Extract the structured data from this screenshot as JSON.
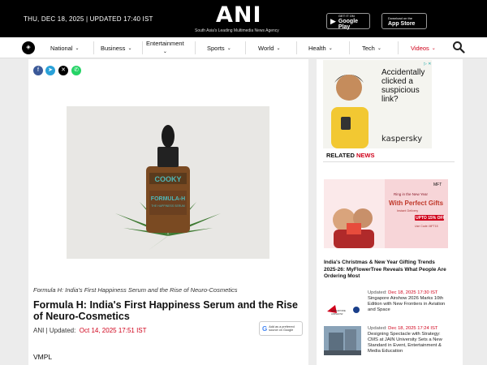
{
  "header": {
    "date_line": "THU, DEC 18, 2025 | UPDATED 17:40 IST",
    "logo": "ANI",
    "tagline": "South Asia's Leading Multimedia News Agency",
    "google_play_small": "GET IT ON",
    "google_play": "Google Play",
    "app_store_small": "Download on the",
    "app_store": "App Store"
  },
  "nav": {
    "items": [
      {
        "label": "National",
        "chevron": "⌄"
      },
      {
        "label": "Business",
        "chevron": "⌄"
      },
      {
        "label": "Entertainment",
        "chevron": "⌄"
      },
      {
        "label": "Sports",
        "chevron": "⌄"
      },
      {
        "label": "World",
        "chevron": "⌄"
      },
      {
        "label": "Health",
        "chevron": "⌄"
      },
      {
        "label": "Tech",
        "chevron": "⌄"
      },
      {
        "label": "Videos",
        "chevron": "⌄"
      }
    ],
    "icons": [
      "ani-logo-icon",
      "search-icon"
    ],
    "videos_color": "#d0021b"
  },
  "article": {
    "share_icons": [
      "facebook-icon",
      "telegram-icon",
      "x-icon",
      "whatsapp-icon"
    ],
    "product_label_brand": "COOKY",
    "product_label_title": "FORMULA-H",
    "product_label_sub": "THE HAPPINESS SERUM",
    "caption": "Formula H: India's First Happiness Serum and the Rise of Neuro-Cosmetics",
    "headline": "Formula H: India's First Happiness Serum and the Rise of Neuro-Cosmetics",
    "byline_source": "ANI",
    "byline_updated": "Updated:",
    "byline_date": "Oct 14, 2025 17:51 IST",
    "preferred_g": "G",
    "preferred_text_1": "Add as a preferred",
    "preferred_text_2": "source on Google",
    "first_line": "VMPL"
  },
  "ad": {
    "headline": "Accidentally clicked a suspicious link?",
    "brand": "kaspersky",
    "adchoice": "▷ ✕"
  },
  "related": {
    "title_1": "RELATED",
    "title_2": "NEWS",
    "banner_brand": "MFT",
    "banner_line_1": "Ring in the New Year",
    "banner_line_2": "With Perfect Gifts",
    "banner_badge": "Instant Delivery",
    "banner_offer": "UPTO 15% OFF",
    "banner_code": "Use Code: MFT15",
    "lead_title": "India's Christmas & New Year Gifting Trends 2025-26: MyFlowerTree Reveals What People Are Ordering Most",
    "items": [
      {
        "updated": "Updated:",
        "date": "Dec 18, 2025 17:30 IST",
        "title": "Singapore Airshow 2026 Marks 10th Edition with New Frontiers in Aviation and Space",
        "thumb_text": "SINGAPORE AIRSHOW"
      },
      {
        "updated": "Updated:",
        "date": "Dec 18, 2025 17:24 IST",
        "title": "Designing Spectacle with Strategy: CMS at JAIN University Sets a New Standard in Event, Entertainment & Media Education"
      }
    ]
  }
}
